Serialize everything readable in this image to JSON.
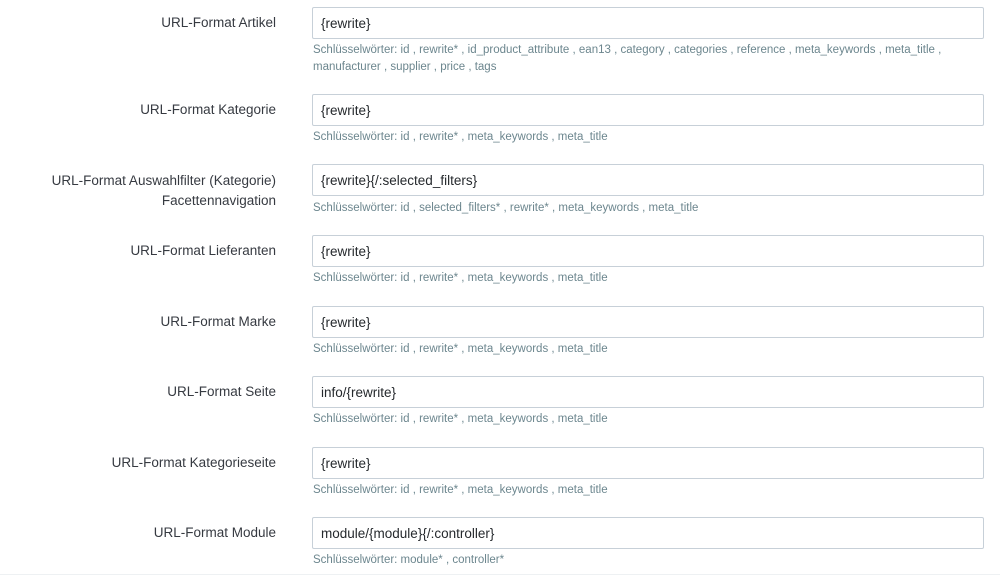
{
  "form": {
    "rows": [
      {
        "label_lines": [
          "URL-Format Artikel"
        ],
        "value": "{rewrite}",
        "help": "Schlüsselwörter: id , rewrite* , id_product_attribute , ean13 , category , categories , reference , meta_keywords , meta_title , manufacturer , supplier , price , tags"
      },
      {
        "label_lines": [
          "URL-Format Kategorie"
        ],
        "value": "{rewrite}",
        "help": "Schlüsselwörter: id , rewrite* , meta_keywords , meta_title"
      },
      {
        "label_lines": [
          "URL-Format Auswahlfilter (Kategorie)",
          "Facettennavigation"
        ],
        "value": "{rewrite}{/:selected_filters}",
        "help": "Schlüsselwörter: id , selected_filters* , rewrite* , meta_keywords , meta_title"
      },
      {
        "label_lines": [
          "URL-Format Lieferanten"
        ],
        "value": "{rewrite}",
        "help": "Schlüsselwörter: id , rewrite* , meta_keywords , meta_title"
      },
      {
        "label_lines": [
          "URL-Format Marke"
        ],
        "value": "{rewrite}",
        "help": "Schlüsselwörter: id , rewrite* , meta_keywords , meta_title"
      },
      {
        "label_lines": [
          "URL-Format Seite"
        ],
        "value": "info/{rewrite}",
        "help": "Schlüsselwörter: id , rewrite* , meta_keywords , meta_title"
      },
      {
        "label_lines": [
          "URL-Format Kategorieseite"
        ],
        "value": "{rewrite}",
        "help": "Schlüsselwörter: id , rewrite* , meta_keywords , meta_title"
      },
      {
        "label_lines": [
          "URL-Format Module"
        ],
        "value": "module/{module}{/:controller}",
        "help": "Schlüsselwörter: module* , controller*"
      }
    ]
  }
}
